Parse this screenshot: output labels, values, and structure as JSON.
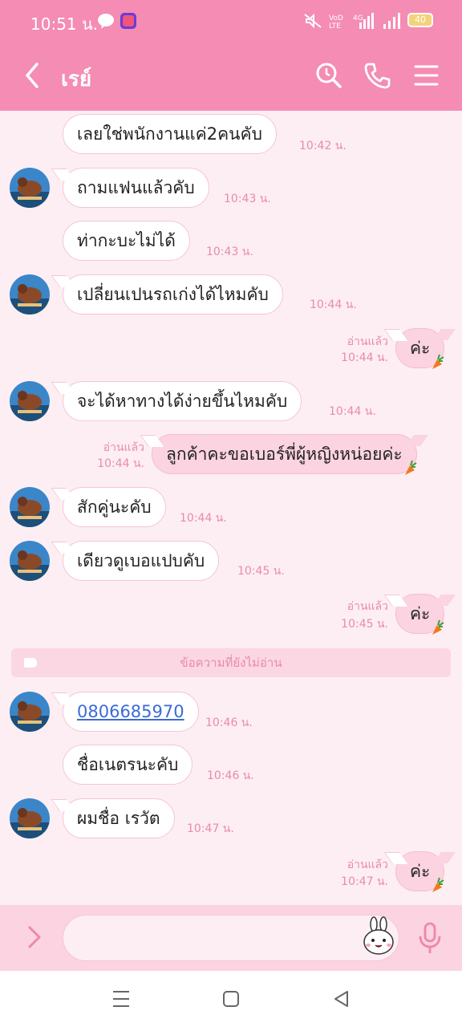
{
  "status_bar": {
    "time": "10:51 น.",
    "battery": "40",
    "icons": [
      "line-notification-icon",
      "app-notification-icon",
      "mute-icon",
      "volte-icon",
      "signal-4g-icon",
      "signal-icon",
      "battery-icon"
    ]
  },
  "header": {
    "title": "เรย์",
    "icons": [
      "back-icon",
      "search-icon",
      "call-icon",
      "menu-icon"
    ]
  },
  "messages": [
    {
      "sender": "them",
      "text": "เลยใช่พนักงานแค่2คนคับ",
      "time": "10:42 น."
    },
    {
      "sender": "them",
      "text": "ถามแฟนแล้วคับ",
      "time": "10:43 น."
    },
    {
      "sender": "them",
      "text": "ท่ากะบะไม่ได้",
      "time": "10:43 น."
    },
    {
      "sender": "them",
      "text": "เปลี่ยนเปนรถเก่งได้ไหมคับ",
      "time": "10:44 น."
    },
    {
      "sender": "me",
      "text": "ค่ะ",
      "read": "อ่านแล้ว",
      "time": "10:44 น."
    },
    {
      "sender": "them",
      "text": "จะได้หาทางได้ง่ายขึ้นไหมคับ",
      "time": "10:44 น."
    },
    {
      "sender": "me",
      "text": "ลูกค้าคะขอเบอร์พี่ผู้หญิงหน่อยค่ะ",
      "read": "อ่านแล้ว",
      "time": "10:44 น."
    },
    {
      "sender": "them",
      "text": "สักคู่นะคับ",
      "time": "10:44 น."
    },
    {
      "sender": "them",
      "text": "เดียวดูเบอแปบคับ",
      "time": "10:45 น."
    },
    {
      "sender": "me",
      "text": "ค่ะ",
      "read": "อ่านแล้ว",
      "time": "10:45 น."
    },
    {
      "sender": "them",
      "text": "0806685970",
      "time": "10:46 น.",
      "is_link": true
    },
    {
      "sender": "them",
      "text": "ชื่อเนตรนะคับ",
      "time": "10:46 น."
    },
    {
      "sender": "them",
      "text": "ผมชื่อ เรวัต",
      "time": "10:47 น."
    },
    {
      "sender": "me",
      "text": "ค่ะ",
      "read": "อ่านแล้ว",
      "time": "10:47 น."
    }
  ],
  "unread_divider": "ข้อความที่ยังไม่อ่าน",
  "input_bar": {
    "placeholder": "",
    "icons": [
      "expand-icon",
      "sticker-icon",
      "mic-icon"
    ]
  },
  "nav_bar": {
    "icons": [
      "recent-apps-icon",
      "home-icon",
      "back-nav-icon"
    ]
  },
  "colors": {
    "header": "#f48cb3",
    "chat_bg": "#fdeef3",
    "my_bubble": "#fbd3e1",
    "their_bubble": "#ffffff",
    "meta_text": "#e98aac",
    "link": "#3b6bd6"
  }
}
